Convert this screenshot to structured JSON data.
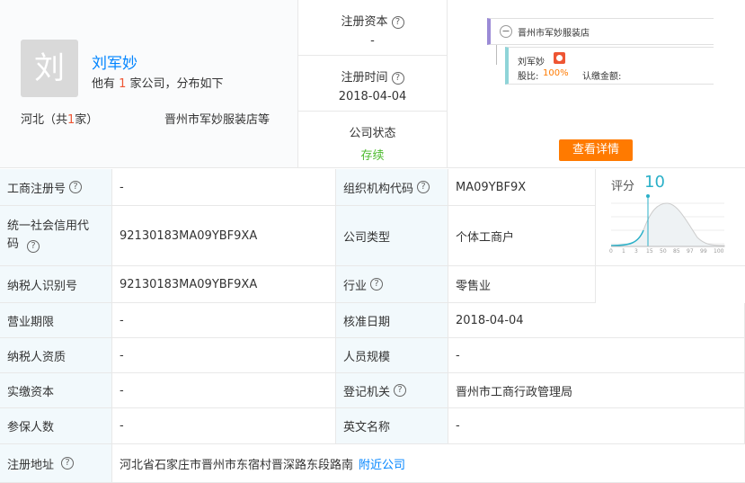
{
  "owner": {
    "avatar_char": "刘",
    "name": "刘军妙",
    "summary_pre": "他有 ",
    "summary_count": "1",
    "summary_post": " 家公司，分布如下",
    "region_pre": "河北（共",
    "region_count": "1",
    "region_post": "家）",
    "companies_text": "晋州市军妙服装店等"
  },
  "stats": [
    {
      "label": "注册资本",
      "value": "-"
    },
    {
      "label": "注册时间",
      "value": "2018-04-04"
    },
    {
      "label": "公司状态",
      "value": "存续"
    }
  ],
  "graph": {
    "company": "晋州市军妙服装店",
    "person": "刘军妙",
    "share_label": "股比:",
    "share_value": "100%",
    "capital_label": "认缴金额:",
    "detail_button": "查看详情",
    "collapse_symbol": "−"
  },
  "score": {
    "label": "评分",
    "value": "10",
    "ticks": [
      "0",
      "1",
      "3",
      "15",
      "50",
      "85",
      "97",
      "99",
      "100"
    ]
  },
  "rows": [
    {
      "l1": "工商注册号",
      "h1": true,
      "v1": "-",
      "l2": "组织机构代码",
      "h2": true,
      "v2": "MA09YBF9X"
    },
    {
      "l1": "统一社会信用代码",
      "h1": true,
      "v1": "92130183MA09YBF9XA",
      "l2": "公司类型",
      "h2": false,
      "v2": "个体工商户"
    },
    {
      "l1": "纳税人识别号",
      "h1": false,
      "v1": "92130183MA09YBF9XA",
      "l2": "行业",
      "h2": true,
      "v2": "零售业"
    },
    {
      "l1": "营业期限",
      "h1": false,
      "v1": "-",
      "l2": "核准日期",
      "h2": false,
      "v2": "2018-04-04"
    },
    {
      "l1": "纳税人资质",
      "h1": false,
      "v1": "-",
      "l2": "人员规模",
      "h2": false,
      "v2": "-"
    },
    {
      "l1": "实缴资本",
      "h1": false,
      "v1": "-",
      "l2": "登记机关",
      "h2": true,
      "v2": "晋州市工商行政管理局"
    },
    {
      "l1": "参保人数",
      "h1": false,
      "v1": "-",
      "l2": "英文名称",
      "h2": false,
      "v2": "-"
    }
  ],
  "address": {
    "label": "注册地址",
    "value": "河北省石家庄市晋州市东宿村晋深路东段路南",
    "nearby_link": "附近公司"
  },
  "colors": {
    "accent_blue": "#0084ff",
    "status_green": "#4cbb2e",
    "orange_button": "#ff7a00",
    "label_bg": "#f2f9fc",
    "score_teal": "#2bb0c8"
  }
}
